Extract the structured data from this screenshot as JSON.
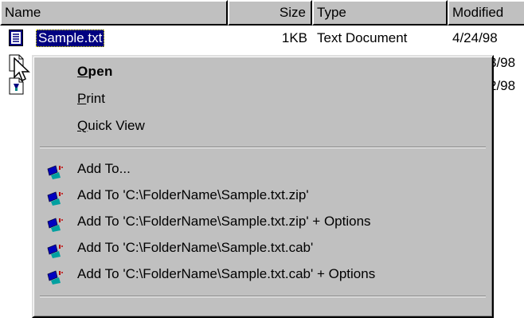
{
  "columns": {
    "name": "Name",
    "size": "Size",
    "type": "Type",
    "modified": "Modified"
  },
  "files": [
    {
      "name": "Sample.txt",
      "size": "1KB",
      "type": "Text Document",
      "modified": "4/24/98",
      "selected": true
    },
    {
      "modified_partial": "3/98"
    },
    {
      "modified_partial": "2/98"
    }
  ],
  "menu": {
    "open": {
      "mnemonic": "O",
      "rest": "pen"
    },
    "print": {
      "mnemonic": "P",
      "rest": "rint"
    },
    "quick_view": {
      "mnemonic": "Q",
      "rest": "uick View"
    },
    "archive_items": [
      "Add To...",
      "Add To 'C:\\FolderName\\Sample.txt.zip'",
      "Add To 'C:\\FolderName\\Sample.txt.zip' + Options",
      "Add To 'C:\\FolderName\\Sample.txt.cab'",
      "Add To 'C:\\FolderName\\Sample.txt.cab' + Options"
    ]
  },
  "colors": {
    "selection": "#000080",
    "menu_bg": "#c0c0c0",
    "header_bg": "#c0c0c0"
  },
  "icons": {
    "text_file": "text-document-icon",
    "help_file": "help-file-icon",
    "archiver": "winzip-icon",
    "pointer": "arrow-cursor-icon"
  }
}
